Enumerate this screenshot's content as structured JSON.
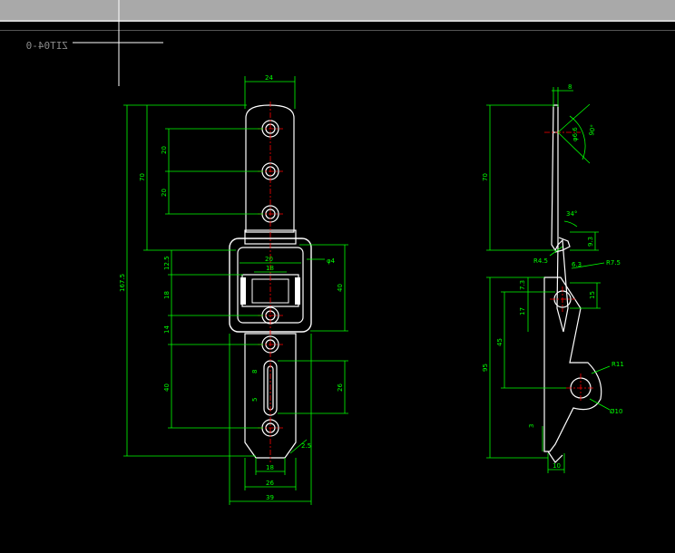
{
  "app": {
    "accent_geometry": "#ffffff",
    "accent_dimension": "#00ff00",
    "accent_center": "#ff0000",
    "background": "#000000"
  },
  "drawing": {
    "label": "ZIT04-0",
    "front_view": {
      "dims": {
        "top_width": "24",
        "total_height": "167.5",
        "upper_70": "70",
        "pitch_20a": "20",
        "pitch_20b": "20",
        "d12_5": "12.5",
        "d18_v": "18",
        "d14": "14",
        "d40_left": "40",
        "w20": "20",
        "w18_top": "18",
        "phi4": "φ4",
        "h40_right": "40",
        "h26_right": "26",
        "slot_8": "8",
        "slot_5": "5",
        "w18_bottom": "18",
        "w26": "26",
        "w39": "39",
        "chamfer": "2.5"
      }
    },
    "side_view": {
      "dims": {
        "t8": "8",
        "phi_hole": "φ6.6",
        "angle90": "90°",
        "h70": "70",
        "angle34": "34°",
        "d9_3": "9.3",
        "r4_5": "R4.5",
        "d6_3": "6.3",
        "r7_5": "R7.5",
        "d7_3": "7.3",
        "d15": "15",
        "d17": "17",
        "d45": "45",
        "d95": "95",
        "r11": "R11",
        "d10_hole": "Ø10",
        "d3": "3",
        "w10": "10"
      }
    }
  }
}
